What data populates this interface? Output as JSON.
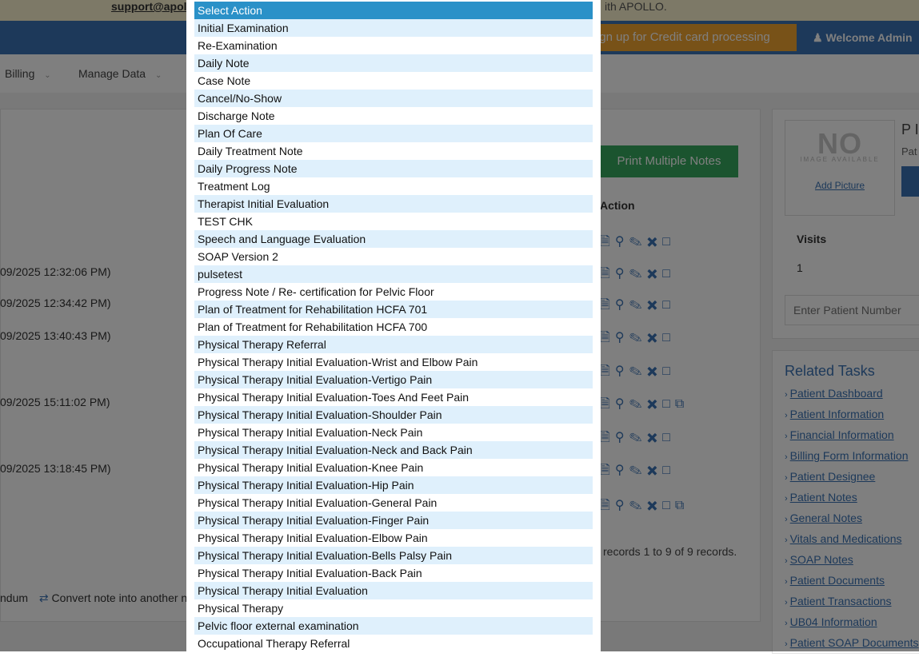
{
  "notice": {
    "email": "support@apoll",
    "text": "ith APOLLO."
  },
  "header": {
    "credit_button": "ign up for Credit card processing",
    "welcome": "Welcome Admin",
    "user_icon": "user-icon"
  },
  "menu": {
    "billing": "Billing",
    "manage_data": "Manage Data"
  },
  "notes_panel": {
    "print_button": "Print Multiple Notes",
    "action_header": "Action",
    "rows": [
      {
        "date": ""
      },
      {
        "date": "09/2025 12:32:06 PM)"
      },
      {
        "date": "09/2025 12:34:42 PM)"
      },
      {
        "date": "09/2025 13:40:43 PM)"
      },
      {
        "date": ""
      },
      {
        "date": "09/2025 15:11:02 PM)"
      },
      {
        "date": ""
      },
      {
        "date": "09/2025 13:18:45 PM)"
      },
      {
        "date": ""
      }
    ],
    "records": "records 1 to 9 of 9 records.",
    "bottom_addendum": "ndum",
    "bottom_convert": "Convert note into another n"
  },
  "patient_card": {
    "no_image": "NO",
    "no_image_sub": "IMAGE AVAILABLE",
    "add_picture": "Add Picture",
    "name": "P I",
    "sub": "Pat",
    "visits_label": "Visits",
    "visits_value": "1",
    "patient_number_placeholder": "Enter Patient Number"
  },
  "related_tasks": {
    "title": "Related Tasks",
    "items": [
      "Patient Dashboard",
      "Patient Information",
      "Financial Information",
      "Billing Form Information",
      "Patient Designee",
      "Patient Notes",
      "General Notes",
      "Vitals and Medications",
      "SOAP Notes",
      "Patient Documents",
      "Patient Transactions",
      "UB04 Information",
      "Patient SOAP Documents"
    ]
  },
  "dropdown": {
    "options": [
      "Select Action",
      "Initial Examination",
      "Re-Examination",
      "Daily Note",
      "Case Note",
      "Cancel/No-Show",
      "Discharge Note",
      "Plan Of Care",
      "Daily Treatment Note",
      "Daily Progress Note",
      "Treatment Log",
      "Therapist Initial Evaluation",
      "TEST CHK",
      "Speech and Language Evaluation",
      "SOAP Version 2",
      "pulsetest",
      "Progress Note / Re- certification for Pelvic Floor",
      "Plan of Treatment for Rehabilitation HCFA 701",
      "Plan of Treatment for Rehabilitation HCFA 700",
      "Physical Therapy Referral",
      "Physical Therapy Initial Evaluation-Wrist and Elbow Pain",
      "Physical Therapy Initial Evaluation-Vertigo Pain",
      "Physical Therapy Initial Evaluation-Toes And Feet Pain",
      "Physical Therapy Initial Evaluation-Shoulder Pain",
      "Physical Therapy Initial Evaluation-Neck Pain",
      "Physical Therapy Initial Evaluation-Neck and Back Pain",
      "Physical Therapy Initial Evaluation-Knee Pain",
      "Physical Therapy Initial Evaluation-Hip Pain",
      "Physical Therapy Initial Evaluation-General Pain",
      "Physical Therapy Initial Evaluation-Finger Pain",
      "Physical Therapy Initial Evaluation-Elbow Pain",
      "Physical Therapy Initial Evaluation-Bells Palsy Pain",
      "Physical Therapy Initial Evaluation-Back Pain",
      "Physical Therapy Initial Evaluation",
      "Physical Therapy",
      "Pelvic floor external examination",
      "Occupational Therapy Referral"
    ],
    "selected_index": 0,
    "colors": {
      "selected": "#2a91c8",
      "alternate": "#dff0fc"
    }
  }
}
